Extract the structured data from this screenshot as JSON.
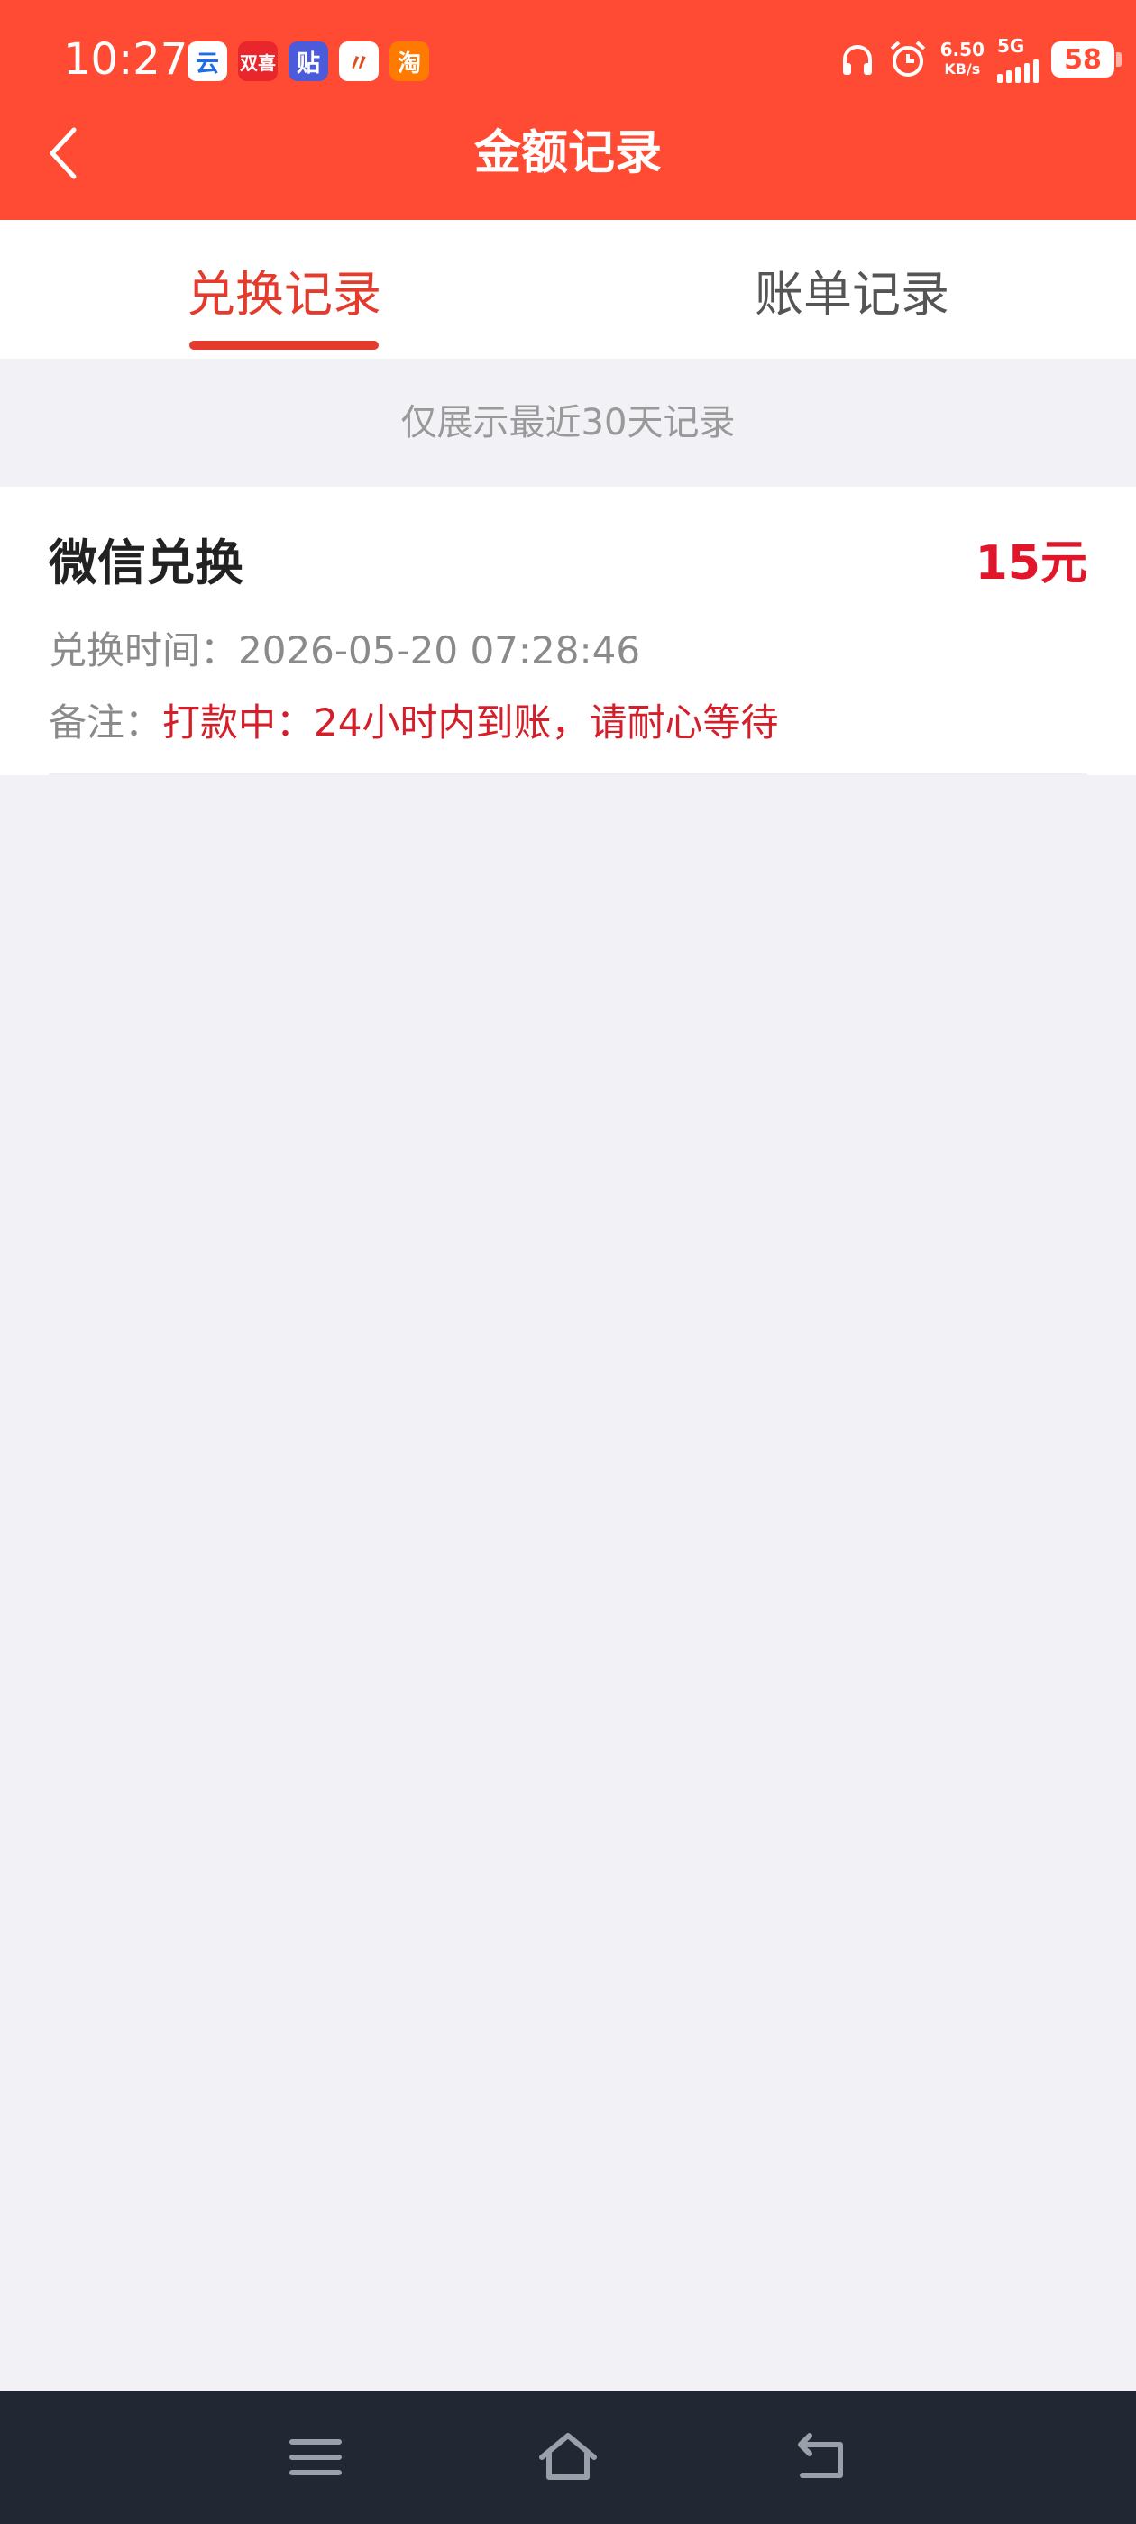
{
  "status_bar": {
    "time": "10:27",
    "apps": [
      "云",
      "双喜",
      "贴",
      "〃",
      "淘"
    ],
    "speed_value": "6.50",
    "speed_unit": "KB/s",
    "network": "5G",
    "battery": "58"
  },
  "header": {
    "title": "金额记录",
    "back_icon": "chevron-left-icon",
    "background": "#ff4b33"
  },
  "tabs": [
    {
      "label": "兑换记录",
      "active": true
    },
    {
      "label": "账单记录",
      "active": false
    }
  ],
  "notice": "仅展示最近30天记录",
  "records": [
    {
      "name": "微信兑换",
      "amount": "15元",
      "time_label": "兑换时间：",
      "time_value": "2026-05-20 07:28:46",
      "note_label": "备注：",
      "note_value": "打款中：24小时内到账，请耐心等待"
    }
  ],
  "nav_bar": {
    "menu_icon": "menu-icon",
    "home_icon": "home-icon",
    "back_icon": "back-icon"
  },
  "colors": {
    "accent": "#e43b2d",
    "amount": "#e2162a",
    "page_bg": "#f1f1f6"
  }
}
